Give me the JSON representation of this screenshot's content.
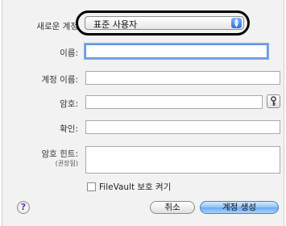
{
  "labels": {
    "new_account": "새로운 계정",
    "name": "이름:",
    "account_name": "계정 이름:",
    "password": "암호:",
    "verify": "확인:",
    "password_hint": "암호 힌트:",
    "recommended": "(권장됨)"
  },
  "account_type": {
    "selected": "표준 사용자"
  },
  "fields": {
    "name": "",
    "account_name": "",
    "password": "",
    "verify": "",
    "password_hint": ""
  },
  "filevault": {
    "label": "FileVault 보호 켜기",
    "checked": false
  },
  "buttons": {
    "cancel": "취소",
    "create": "계정 생성",
    "help": "?"
  },
  "icons": {
    "key": "key-icon",
    "help": "question-icon",
    "popup": "up-down-arrows-icon"
  },
  "colors": {
    "accent": "#6aaaf0",
    "focus_ring": "#78a9ec",
    "highlight_ring": "#000000"
  }
}
